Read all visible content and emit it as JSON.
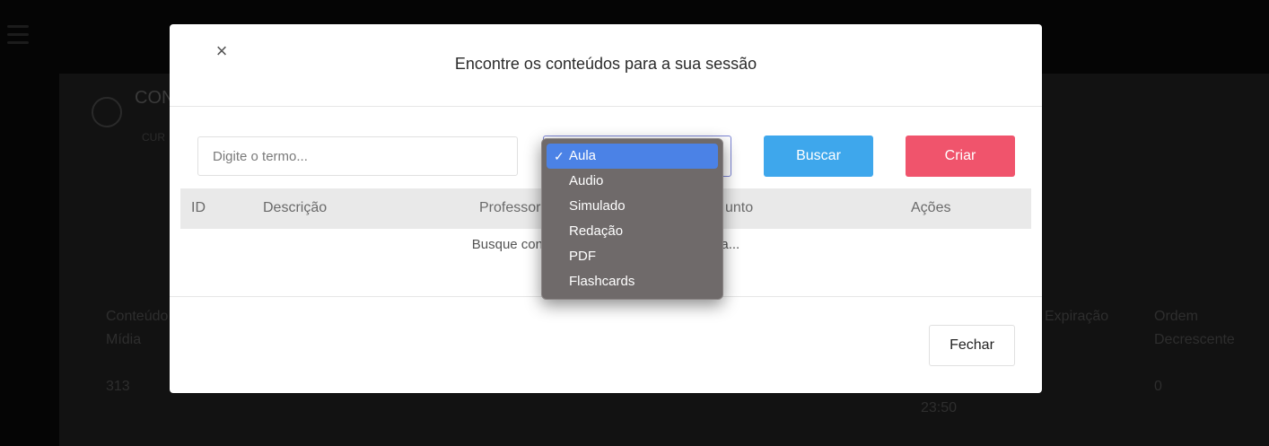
{
  "background": {
    "title": "CON",
    "subtitle": "CUR",
    "columns": [
      "Conteúdo",
      "Mídia",
      "Expiração",
      "Ordem",
      "Decrescente"
    ],
    "row": {
      "id": "313",
      "time": "23:50",
      "order": "0"
    }
  },
  "modal": {
    "title": "Encontre os conteúdos para a sua sessão",
    "close_symbol": "×",
    "search": {
      "placeholder": "Digite o termo..."
    },
    "type_select": {
      "selected": "Aula",
      "chevron": "⌄"
    },
    "buttons": {
      "search": "Buscar",
      "create": "Criar",
      "close": "Fechar"
    },
    "table": {
      "headers": [
        "ID",
        "Descrição",
        "Professor",
        "unto",
        "Ações"
      ]
    },
    "empty_message": "Busque conteú                                   acima..."
  },
  "dropdown": {
    "check_symbol": "✓",
    "options": [
      "Aula",
      "Audio",
      "Simulado",
      "Redação",
      "PDF",
      "Flashcards"
    ]
  },
  "colors": {
    "accent_blue": "#3ea7ec",
    "accent_red": "#f0546c",
    "dropdown_selected": "#4b82e6"
  },
  "icons": {
    "close": "close-icon",
    "chevron": "chevron-down-icon",
    "check": "check-icon",
    "menu": "hamburger-icon"
  }
}
